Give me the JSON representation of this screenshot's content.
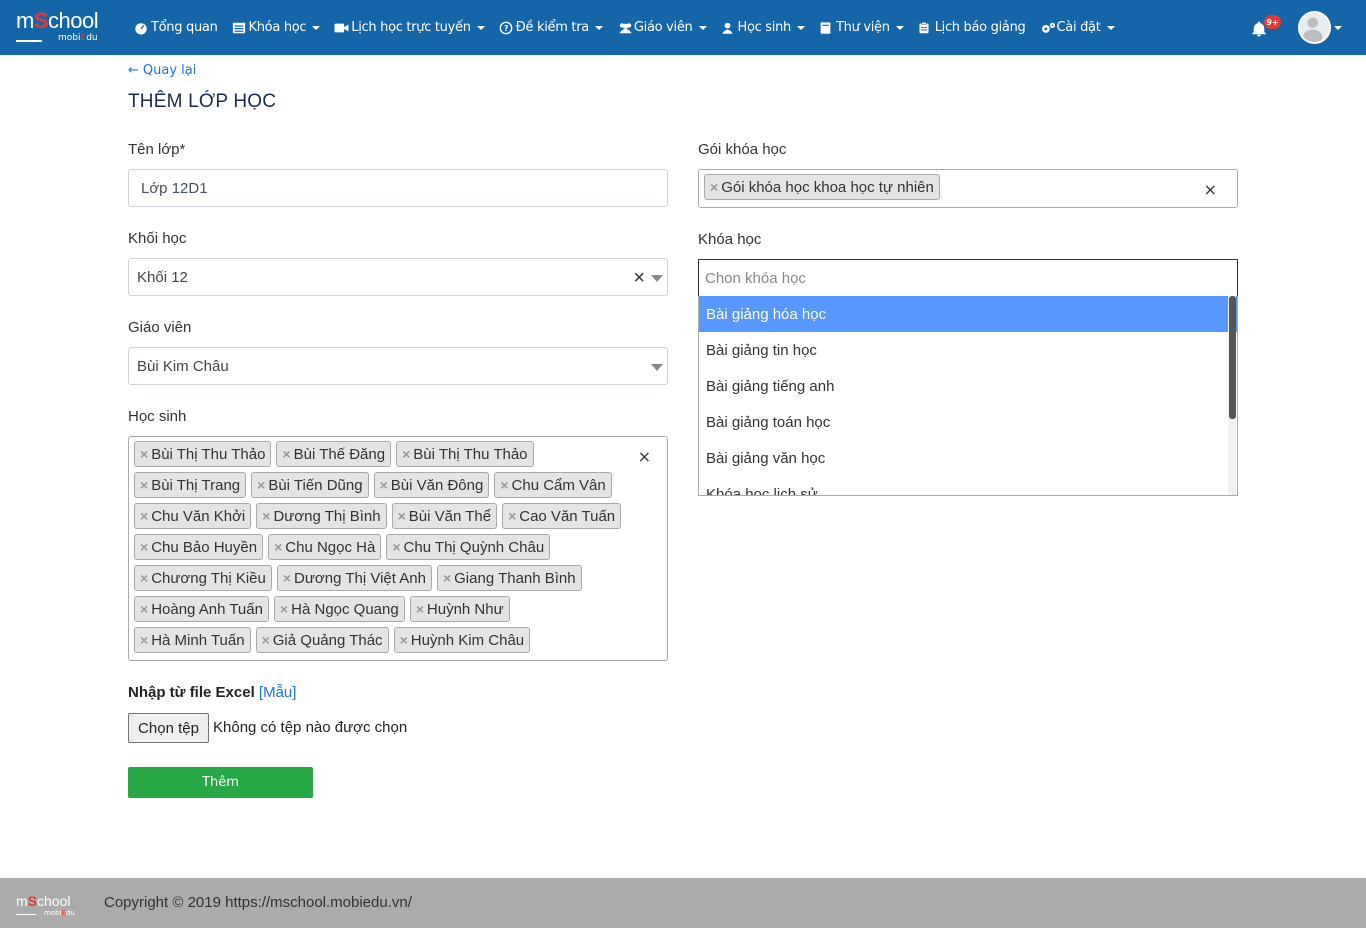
{
  "brand": {
    "name_pre": "m",
    "name_s": "S",
    "name_post": "chool",
    "sub_pre": "mobi",
    "sub_e": "E",
    "sub_post": "du"
  },
  "nav": [
    {
      "label": "Tổng quan",
      "icon": "dashboard-icon",
      "has_caret": false
    },
    {
      "label": "Khóa học",
      "icon": "list-icon",
      "has_caret": true
    },
    {
      "label": "Lịch học trực tuyến",
      "icon": "video-icon",
      "has_caret": true
    },
    {
      "label": "Đề kiểm tra",
      "icon": "question-icon",
      "has_caret": true
    },
    {
      "label": "Giáo viên",
      "icon": "users-icon",
      "has_caret": true
    },
    {
      "label": "Học sinh",
      "icon": "user-icon",
      "has_caret": true
    },
    {
      "label": "Thư viện",
      "icon": "book-icon",
      "has_caret": true
    },
    {
      "label": "Lịch báo giảng",
      "icon": "clipboard-icon",
      "has_caret": false
    },
    {
      "label": "Cài đặt",
      "icon": "cogs-icon",
      "has_caret": true
    }
  ],
  "notifications": {
    "badge": "9+"
  },
  "back_label": "Quay lại",
  "page_title": "THÊM LỚP HỌC",
  "form": {
    "class_name_label": "Tên lớp*",
    "class_name_value": "Lớp 12D1",
    "grade_label": "Khối học",
    "grade_value": "Khối 12",
    "teacher_label": "Giáo viên",
    "teacher_value": "Bùi Kim Châu",
    "students_label": "Học sinh",
    "students": [
      "Bùi Thị Thu Thảo",
      "Bùi Thế Đăng",
      "Bùi Thị Thu Thảo",
      "Bùi Thị Trang",
      "Bùi Tiến Dũng",
      "Bùi Văn Đông",
      "Chu Cẩm Vân",
      "Chu Văn Khởi",
      "Dương Thị Bình",
      "Bùi Văn Thể",
      "Cao Văn Tuấn",
      "Chu Bảo Huyền",
      "Chu Ngọc Hà",
      "Chu Thị Quỳnh Châu",
      "Chương Thị Kiều",
      "Dương Thị Việt Anh",
      "Giang Thanh Bình",
      "Hoàng Anh Tuấn",
      "Hà Ngọc Quang",
      "Huỳnh Như",
      "Hà Minh Tuấn",
      "Giả Quảng Thác",
      "Huỳnh Kim Châu"
    ],
    "package_label": "Gói khóa học",
    "package_tag": "Gói khóa học khoa học tự nhiên",
    "course_label": "Khóa học",
    "course_placeholder": "Chon khóa học",
    "course_options": [
      "Bài giảng hóa học",
      "Bài giảng tin học",
      "Bài giảng tiếng anh",
      "Bài giảng toán học",
      "Bài giảng văn học",
      "Khóa học lịch sử"
    ],
    "excel_label": "Nhập từ file Excel",
    "excel_sample_open": "[",
    "excel_sample": "Mẫu",
    "excel_sample_close": "]",
    "file_button": "Chọn tệp",
    "file_status": "Không có tệp nào được chọn",
    "submit_label": "Thêm"
  },
  "footer": {
    "copyright": "Copyright © 2019 https://mschool.mobiedu.vn/"
  }
}
